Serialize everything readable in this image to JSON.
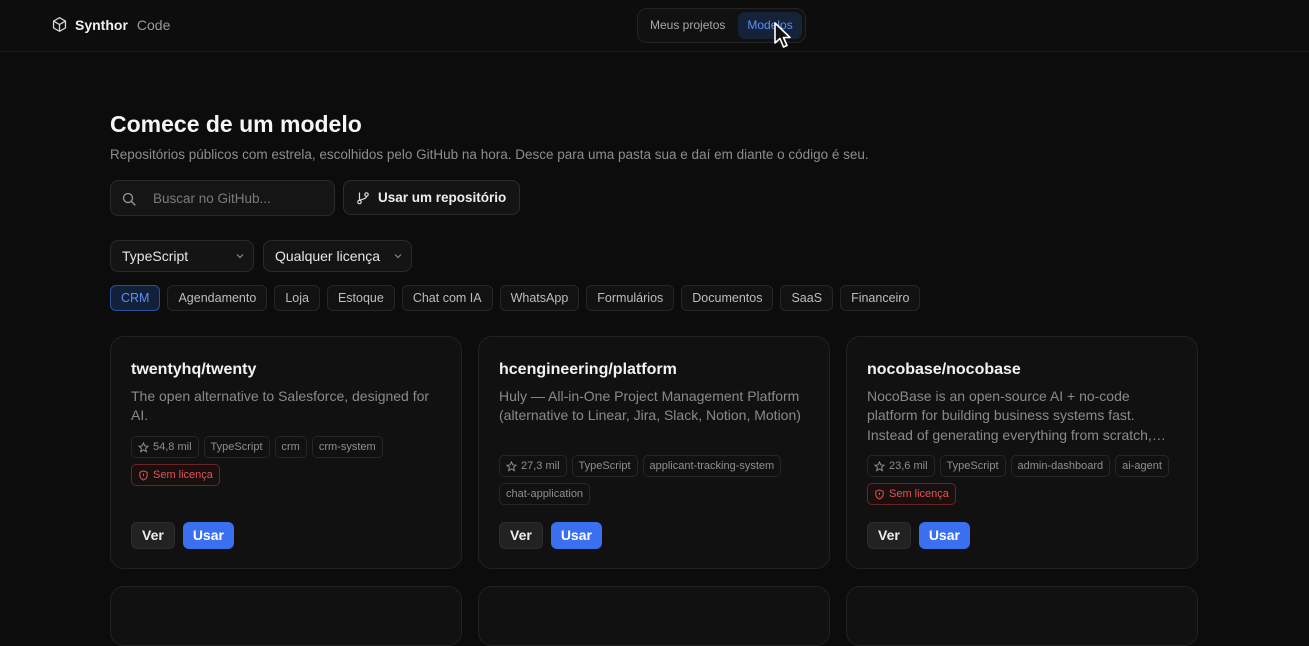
{
  "brand": {
    "name": "Synthor",
    "sub": "Code"
  },
  "nav": {
    "tabs": [
      {
        "label": "Meus projetos",
        "active": false
      },
      {
        "label": "Modelos",
        "active": true
      }
    ]
  },
  "header": {
    "title": "Comece de um modelo",
    "subtitle": "Repositórios públicos com estrela, escolhidos pelo GitHub na hora. Desce para uma pasta sua e daí em diante o código é seu."
  },
  "search": {
    "placeholder": "Buscar no GitHub..."
  },
  "repo_button": {
    "label": "Usar um repositório"
  },
  "filters": {
    "language": "TypeScript",
    "license": "Qualquer licença"
  },
  "chips": [
    "CRM",
    "Agendamento",
    "Loja",
    "Estoque",
    "Chat com IA",
    "WhatsApp",
    "Formulários",
    "Documentos",
    "SaaS",
    "Financeiro"
  ],
  "active_chip": "CRM",
  "colors": {
    "accent": "#3a6ff0",
    "danger": "#e05555",
    "background": "#0c0c0c"
  },
  "cards": [
    {
      "repo": "twentyhq/twenty",
      "desc": "The open alternative to Salesforce, designed for AI.",
      "stars": "54,8 mil",
      "tags": [
        "TypeScript",
        "crm",
        "crm-system"
      ],
      "no_license": "Sem licença",
      "ver": "Ver",
      "usar": "Usar"
    },
    {
      "repo": "hcengineering/platform",
      "desc": "Huly — All-in-One Project Management Platform (alternative to Linear, Jira, Slack, Notion, Motion)",
      "stars": "27,3 mil",
      "tags": [
        "TypeScript",
        "applicant-tracking-system",
        "chat-application"
      ],
      "ver": "Ver",
      "usar": "Usar"
    },
    {
      "repo": "nocobase/nocobase",
      "desc": "NocoBase is an open-source AI + no-code platform for building business systems fast. Instead of generating everything from scratch,…",
      "stars": "23,6 mil",
      "tags": [
        "TypeScript",
        "admin-dashboard",
        "ai-agent"
      ],
      "no_license": "Sem licença",
      "ver": "Ver",
      "usar": "Usar"
    }
  ]
}
